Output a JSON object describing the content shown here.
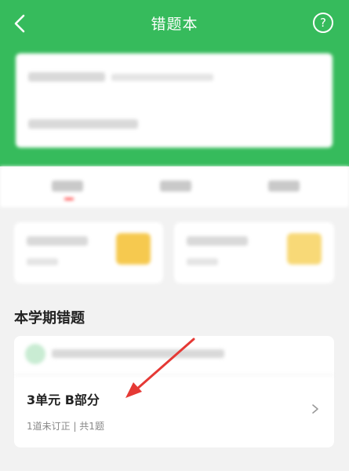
{
  "header": {
    "title": "错题本",
    "help_label": "?"
  },
  "section": {
    "title": "本学期错题"
  },
  "unit_card": {
    "title": "3单元 B部分",
    "meta": "1道未订正 | 共1题"
  },
  "colors": {
    "brand_green": "#36bb5c",
    "annotation_red": "#e53935"
  },
  "icons": [
    "back-arrow-icon",
    "help-circle-icon",
    "chevron-right-icon"
  ]
}
